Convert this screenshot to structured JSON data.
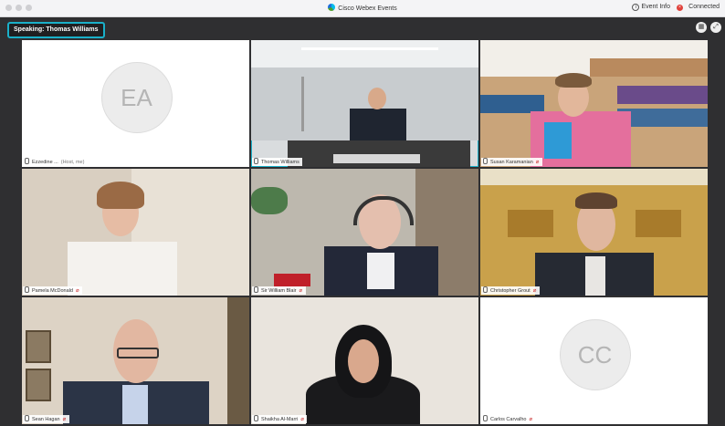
{
  "window": {
    "title": "Cisco Webex Events",
    "event_info": "Event Info",
    "status": "Connected"
  },
  "speaking": {
    "label": "Speaking:",
    "name": "Thomas Williams"
  },
  "participants": [
    {
      "name": "Ezzedine ...",
      "status": "(Host, me)",
      "initials": "EA",
      "video": false
    },
    {
      "name": "Thomas Williams",
      "video": true,
      "active": true
    },
    {
      "name": "Susan Karamanian",
      "video": true
    },
    {
      "name": "Pamela McDonald",
      "video": true
    },
    {
      "name": "Sir William Blair",
      "video": true
    },
    {
      "name": "Christopher Grout",
      "video": true
    },
    {
      "name": "Sean Hagan",
      "video": true
    },
    {
      "name": "Shaikha Al-Marri",
      "video": true
    },
    {
      "name": "Carlos Carvalho",
      "initials": "CC",
      "video": false
    }
  ],
  "icons": {
    "app_logo": "webex-logo-icon",
    "info": "info-icon",
    "leave": "close-circle-icon",
    "layout": "grid-layout-icon",
    "fullscreen": "fullscreen-icon",
    "mic": "microphone-icon"
  },
  "colors": {
    "speaking_border": "#1ab0c9",
    "background": "#2f2f31",
    "leave": "#e0403a"
  }
}
